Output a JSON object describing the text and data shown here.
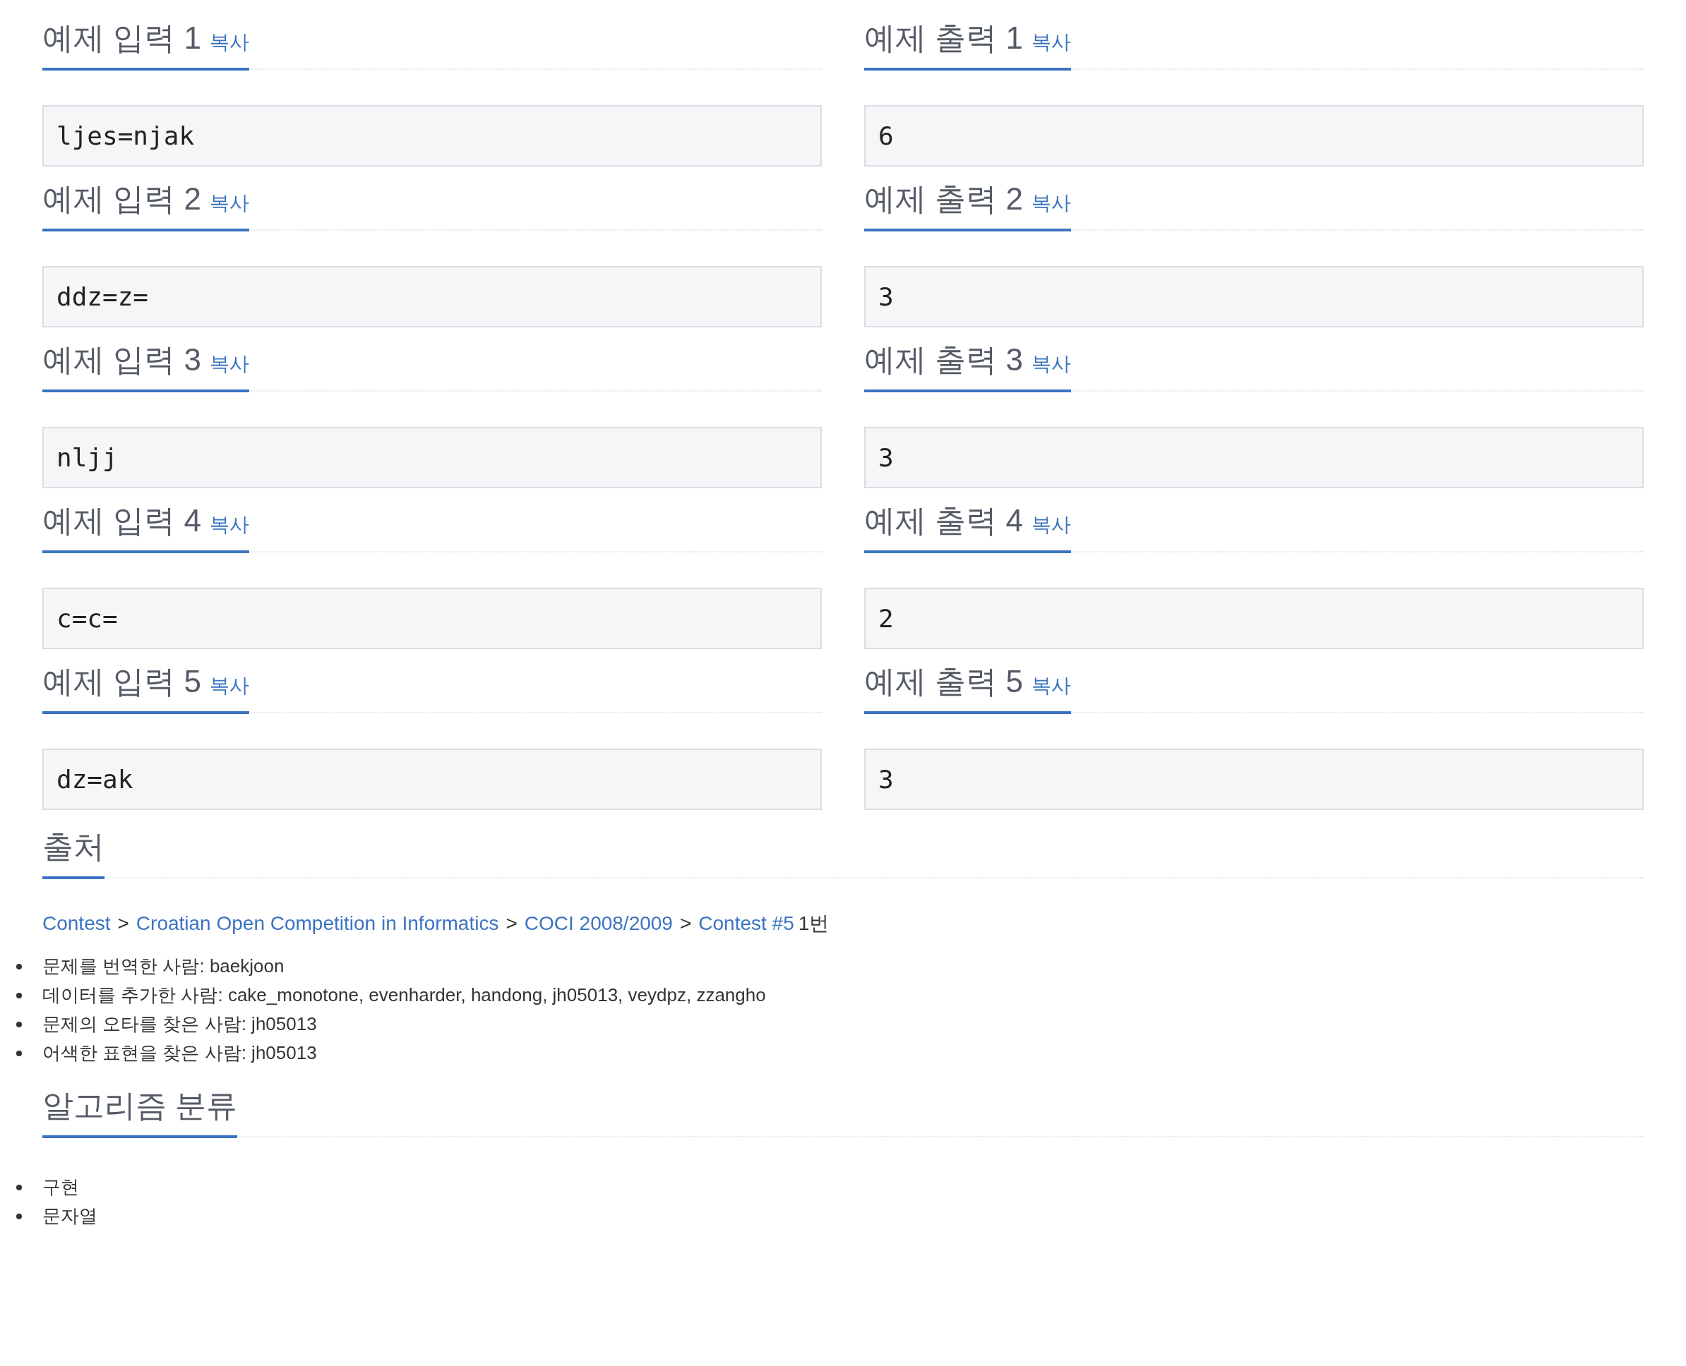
{
  "samples": [
    {
      "input": {
        "title": "예제 입력 1",
        "copy": "복사",
        "value": "ljes=njak"
      },
      "output": {
        "title": "예제 출력 1",
        "copy": "복사",
        "value": "6"
      }
    },
    {
      "input": {
        "title": "예제 입력 2",
        "copy": "복사",
        "value": "ddz=z="
      },
      "output": {
        "title": "예제 출력 2",
        "copy": "복사",
        "value": "3"
      }
    },
    {
      "input": {
        "title": "예제 입력 3",
        "copy": "복사",
        "value": "nljj"
      },
      "output": {
        "title": "예제 출력 3",
        "copy": "복사",
        "value": "3"
      }
    },
    {
      "input": {
        "title": "예제 입력 4",
        "copy": "복사",
        "value": "c=c="
      },
      "output": {
        "title": "예제 출력 4",
        "copy": "복사",
        "value": "2"
      }
    },
    {
      "input": {
        "title": "예제 입력 5",
        "copy": "복사",
        "value": "dz=ak"
      },
      "output": {
        "title": "예제 출력 5",
        "copy": "복사",
        "value": "3"
      }
    }
  ],
  "source": {
    "title": "출처",
    "breadcrumb": [
      {
        "kind": "link",
        "text": "Contest"
      },
      {
        "kind": "separator",
        "text": ">"
      },
      {
        "kind": "link",
        "text": "Croatian Open Competition in Informatics"
      },
      {
        "kind": "separator",
        "text": ">"
      },
      {
        "kind": "link",
        "text": "COCI 2008/2009"
      },
      {
        "kind": "separator",
        "text": ">"
      },
      {
        "kind": "link",
        "text": "Contest #5"
      },
      {
        "kind": "text",
        "text": "1번"
      }
    ],
    "credits": [
      "문제를 번역한 사람: baekjoon",
      "데이터를 추가한 사람: cake_monotone, evenharder, handong, jh05013, veydpz, zzangho",
      "문제의 오타를 찾은 사람: jh05013",
      "어색한 표현을 찾은 사람: jh05013"
    ]
  },
  "algorithms": {
    "title": "알고리즘 분류",
    "items": [
      "구현",
      "문자열"
    ]
  }
}
